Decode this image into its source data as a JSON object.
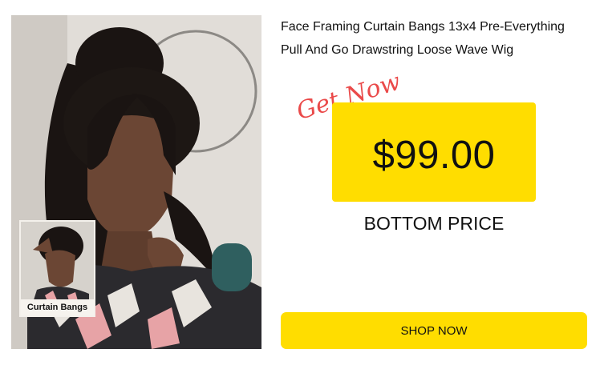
{
  "product": {
    "title": "Face Framing Curtain Bangs 13x4 Pre-Everything Pull And Go Drawstring Loose Wave Wig",
    "thumbnail_label": "Curtain Bangs"
  },
  "promo": {
    "get_now": "Get Now",
    "price": "$99.00",
    "price_caption": "BOTTOM PRICE"
  },
  "actions": {
    "shop_now": "SHOP NOW"
  },
  "colors": {
    "accent_yellow": "#ffdd00",
    "get_now_red": "#ea4a4a",
    "text": "#111111"
  }
}
